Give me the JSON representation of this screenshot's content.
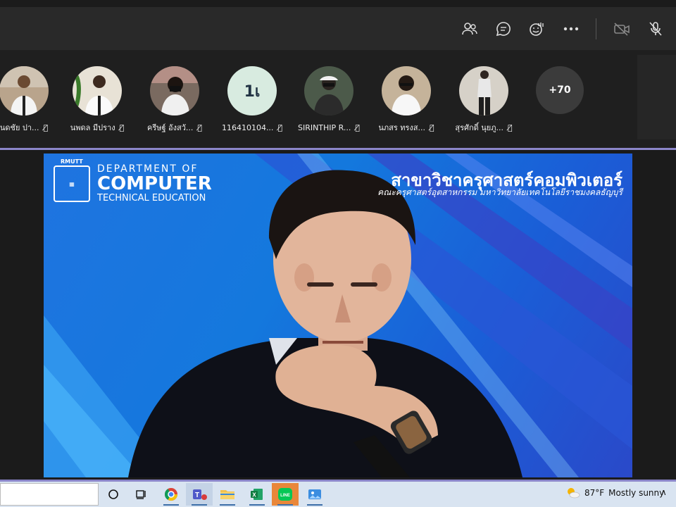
{
  "toolbar": {
    "buttons": [
      {
        "name": "participants-button",
        "icon": "people-icon"
      },
      {
        "name": "chat-button",
        "icon": "chat-icon"
      },
      {
        "name": "reactions-button",
        "icon": "raise-hand-icon"
      },
      {
        "name": "more-actions-button",
        "icon": "more-icon"
      },
      {
        "name": "camera-toggle-button",
        "icon": "camera-off-icon"
      },
      {
        "name": "mic-toggle-button",
        "icon": "mic-off-icon"
      }
    ]
  },
  "participants": [
    {
      "name": "นดชัย ปา..."
    },
    {
      "name": "นพดล มีปราง"
    },
    {
      "name": "ครีษฐ์ อังสวั..."
    },
    {
      "name": "116410104...",
      "initials": "1เ"
    },
    {
      "name": "SIRINTHIP R..."
    },
    {
      "name": "นภสร ทรงส..."
    },
    {
      "name": "สุรศักดิ์ นุยภู..."
    }
  ],
  "more_participants": "+70",
  "video": {
    "logo_top": "RMUTT",
    "dept_line1": "DEPARTMENT OF",
    "dept_line2": "COMPUTER",
    "dept_line3": "TECHNICAL EDUCATION",
    "thai_title": "สาขาวิชาครุศาสตร์คอมพิวเตอร์",
    "thai_subtitle": "คณะครุศาสตร์อุตสาหกรรม มหาวิทยาลัยเทคโนโลยีราชมงคลธัญบุรี"
  },
  "taskbar": {
    "weather_temp": "87°F",
    "weather_text": "Mostly sunny"
  }
}
